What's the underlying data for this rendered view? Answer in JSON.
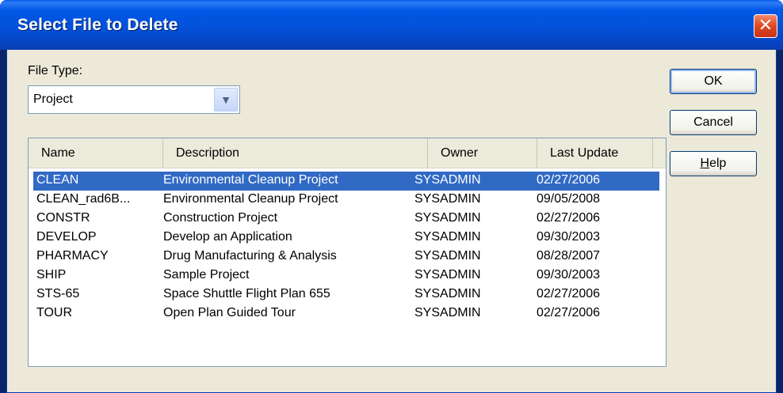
{
  "window": {
    "title": "Select File to Delete",
    "close_glyph": "✕"
  },
  "file_type": {
    "label": "File Type:",
    "value": "Project",
    "dropdown_glyph": "▼"
  },
  "list": {
    "columns": [
      "Name",
      "Description",
      "Owner",
      "Last Update"
    ],
    "rows": [
      {
        "name": "CLEAN",
        "description": "Environmental Cleanup Project",
        "owner": "SYSADMIN",
        "last_update": "02/27/2006"
      },
      {
        "name": "CLEAN_rad6B...",
        "description": "Environmental Cleanup Project",
        "owner": "SYSADMIN",
        "last_update": "09/05/2008"
      },
      {
        "name": "CONSTR",
        "description": "Construction Project",
        "owner": "SYSADMIN",
        "last_update": "02/27/2006"
      },
      {
        "name": "DEVELOP",
        "description": "Develop an Application",
        "owner": "SYSADMIN",
        "last_update": "09/30/2003"
      },
      {
        "name": "PHARMACY",
        "description": "Drug Manufacturing & Analysis",
        "owner": "SYSADMIN",
        "last_update": "08/28/2007"
      },
      {
        "name": "SHIP",
        "description": "Sample Project",
        "owner": "SYSADMIN",
        "last_update": "09/30/2003"
      },
      {
        "name": "STS-65",
        "description": "Space Shuttle Flight Plan 655",
        "owner": "SYSADMIN",
        "last_update": "02/27/2006"
      },
      {
        "name": "TOUR",
        "description": "Open Plan Guided Tour",
        "owner": "SYSADMIN",
        "last_update": "02/27/2006"
      }
    ],
    "selected_row": 0
  },
  "buttons": {
    "ok": "OK",
    "cancel": "Cancel",
    "help": "Help"
  },
  "colors": {
    "title_bar": "#0058e6",
    "selection": "#316ac5",
    "dialog_bg": "#ece9d8",
    "close": "#e0461f"
  }
}
